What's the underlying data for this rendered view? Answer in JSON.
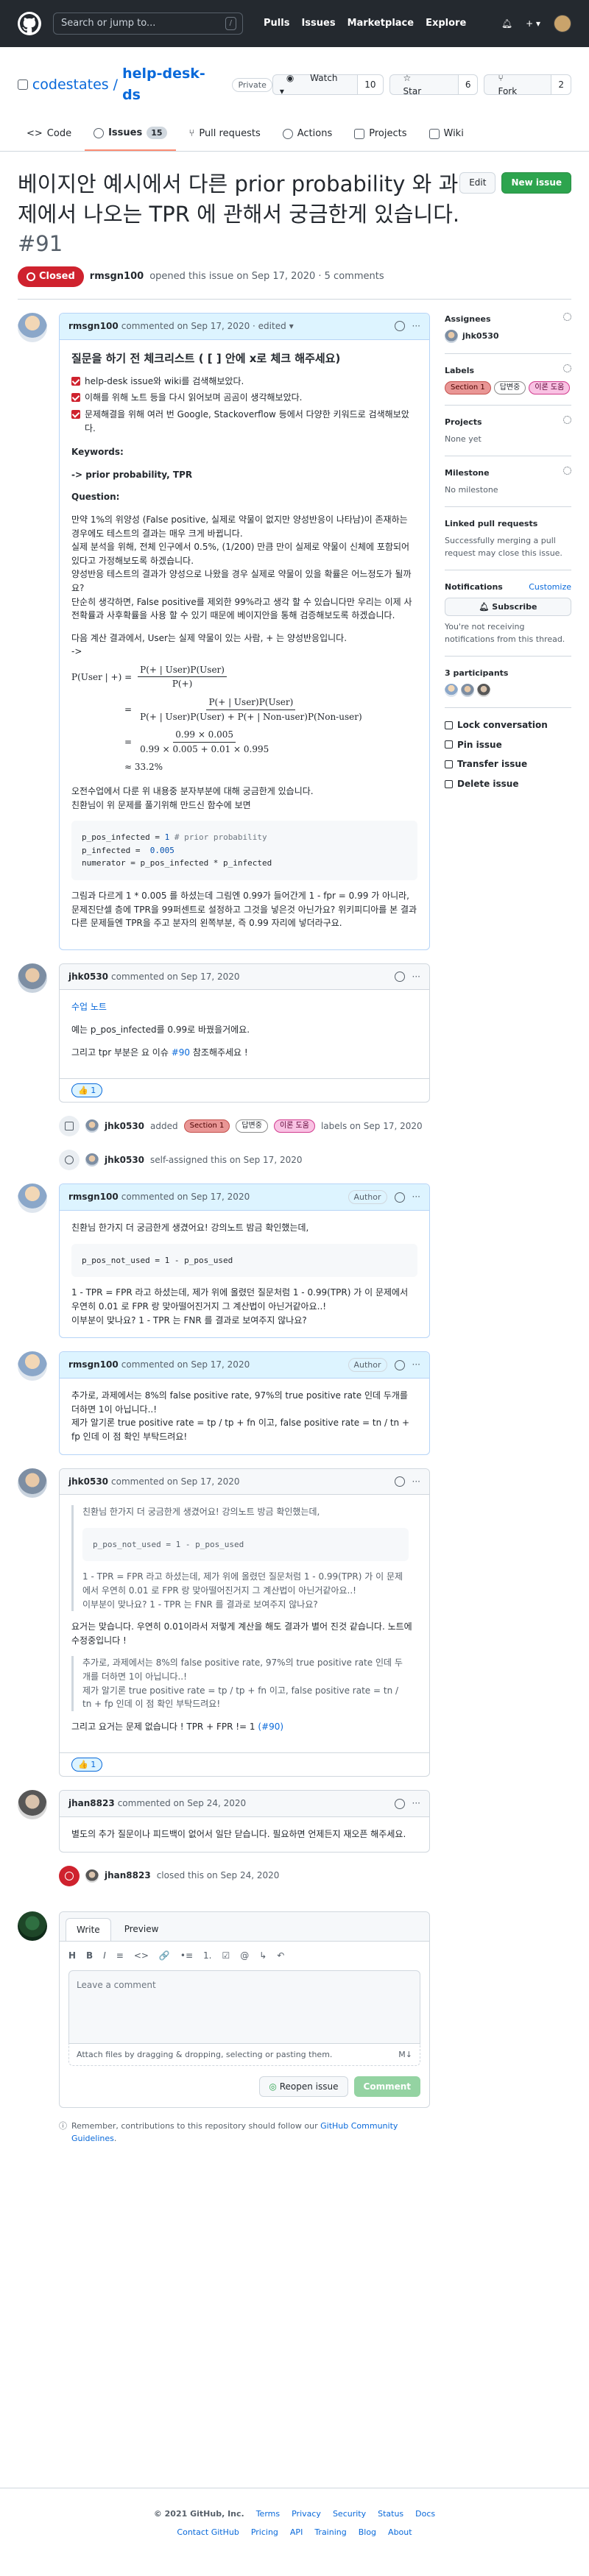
{
  "header": {
    "search_placeholder": "Search or jump to...",
    "search_key": "/",
    "nav": [
      "Pulls",
      "Issues",
      "Marketplace",
      "Explore"
    ]
  },
  "repo": {
    "owner": "codestates",
    "sep": "/",
    "name": "help-desk-ds",
    "visibility": "Private",
    "watch_label": "Watch",
    "watch_count": "10",
    "star_label": "Star",
    "star_count": "6",
    "fork_label": "Fork",
    "fork_count": "2",
    "tabs": [
      {
        "label": "Code"
      },
      {
        "label": "Issues",
        "count": "15"
      },
      {
        "label": "Pull requests"
      },
      {
        "label": "Actions"
      },
      {
        "label": "Projects"
      },
      {
        "label": "Wiki"
      }
    ]
  },
  "issue": {
    "title": "베이지안 예시에서 다른 prior probability 와 과제에서 나오는 TPR 에 관해서 궁금한게 있습니다.",
    "number": "#91",
    "edit_label": "Edit",
    "new_issue_label": "New issue",
    "state": "Closed",
    "author": "rmsgn100",
    "opened_text": "opened this issue on Sep 17, 2020 · 5 comments"
  },
  "comment1": {
    "author": "rmsgn100",
    "meta": "commented on Sep 17, 2020 · edited",
    "heading": "질문을 하기 전 체크리스트 ( [ ] 안에 x로 체크 해주세요)",
    "tasks": [
      "help-desk issue와 wiki를 검색해보았다.",
      "이해를 위해 노트 등을 다시 읽어보며 곰곰이 생각해보았다.",
      "문제해결을 위해 여러 번 Google, Stackoverflow 등에서 다양한 키워드로 검색해보았다."
    ],
    "keywords_label": "Keywords:",
    "keywords": "-> prior probability, TPR",
    "question_label": "Question:",
    "q1": "만약 1%의 위양성 (False positive, 실제로 약물이 없지만 양성반응이 나타남)이 존재하는 경우에도 테스트의 결과는 매우 크게 바뀝니다.",
    "q2": "실제 분석을 위해, 전체 인구에서 0.5%, (1/200) 만큼 만이 실제로 약물이 신체에 포함되어 있다고 가정해보도록 하겠습니다.",
    "q3": "양성반응 테스트의 결과가 양성으로 나왔을 경우 실제로 약물이 있을 확률은 어느정도가 될까요?",
    "q4": "단순히 생각하면, False positive를 제외한 99%라고 생각 할 수 있습니다만 우리는 이제 사전확률과 사후확률을 사용 할 수 있기 때문에 베이지안을 통해 검증해보도록 하겠습니다.",
    "q5": "다음 계산 결과에서, User는 실제 약물이 있는 사람, + 는 양성반응입니다.",
    "q6": "->",
    "math": {
      "lhs": "P(User | +) =",
      "n1": "P(+ | User)P(User)",
      "d1": "P(+)",
      "n2": "P(+ | User)P(User)",
      "d2": "P(+ | User)P(User) + P(+ | Non-user)P(Non-user)",
      "n3": "0.99 × 0.005",
      "d3": "0.99 × 0.005 + 0.01 × 0.995",
      "eq": "=",
      "approx": "≈ 33.2%"
    },
    "p1": "오전수업에서 다룬 위 내용중 분자부분에 대해 궁금한게 있습니다.",
    "p2": "친환님이 위 문제를 풀기위해 만드신 함수에 보면",
    "code": [
      {
        "pre": "p_pos_infected = ",
        "num": "1",
        "cm": " # prior probability"
      },
      {
        "pre": "p_infected = ",
        "num": " 0.005",
        "cm": ""
      },
      {
        "pre": "numerator = p_pos_infected * p_infected",
        "num": "",
        "cm": ""
      }
    ],
    "p3": "그림과 다르게 1 * 0.005 를 하셨는데 그림엔 0.99가 들어간게 1 - fpr = 0.99 가 아니라, 문제진단셀 층에 TPR을 99퍼센트로 설정하고 그것을 넣은것 아닌가요? 위키피디아를 본 결과 다른 문제들엔 TPR을 주고 분자의 왼쪽부분, 즉 0.99 자리에 넣더라구요."
  },
  "comment2": {
    "author": "jhk0530",
    "meta": "commented on Sep 17, 2020",
    "link": "수업 노트",
    "p1": "예는 p_pos_infected를 0.99로 바꿨을거에요.",
    "p2": "그리고 tpr 부분은 요 이슈",
    "ref": "#90",
    "p2b": "참조해주세요 !",
    "reaction": "👍 1"
  },
  "event1": {
    "actor": "jhk0530",
    "action": "added",
    "labels": [
      "Section 1",
      "답변중",
      "이론 도움"
    ],
    "suffix": "labels on Sep 17, 2020"
  },
  "event2": {
    "actor": "jhk0530",
    "text": "self-assigned this on Sep 17, 2020"
  },
  "comment3": {
    "author": "rmsgn100",
    "meta": "commented on Sep 17, 2020",
    "tag": "Author",
    "p1": "친환님 한가지 더 궁금한게 생겼어요! 강의노트 밤금 확인했는데,",
    "code": "p_pos_not_used = 1 - p_pos_used",
    "p2": "1 - TPR = FPR 라고 하셨는데, 제가 위에 올렸던 질문처럼 1 - 0.99(TPR) 가 이 문제에서 우연히 0.01 로 FPR 랑 맞아떨어진거지 그 계산법이 아닌거같아요..!",
    "p3": "이부분이 맞나요? 1 - TPR 는 FNR 를 결과로 보여주지 않나요?"
  },
  "comment4": {
    "author": "rmsgn100",
    "meta": "commented on Sep 17, 2020",
    "tag": "Author",
    "p1": "추가로, 과제에서는 8%의 false positive rate, 97%의 true positive rate 인데 두개를 더하면 1이 아닙니다..!",
    "p2": "제가 알기론 true positive rate = tp / tp + fn 이고, false positive rate = tn / tn + fp 인데 이 점 확인 부탁드려요!"
  },
  "comment5": {
    "author": "jhk0530",
    "meta": "commented on Sep 17, 2020",
    "q1": "친환님 한가지 더 궁금한게 생겼어요! 강의노트 방금 확인했는데,",
    "qcode": "p_pos_not_used = 1 - p_pos_used",
    "q2": "1 - TPR = FPR 라고 하셨는데, 제가 위에 올렸던 질문처럼 1 - 0.99(TPR) 가 이 문제에서 우연히 0.01 로 FPR 랑 맞아떨어진거지 그 계산법이 아닌거같아요..!",
    "q3": "이부분이 맞나요? 1 - TPR 는 FNR 를 결과로 보여주지 않나요?",
    "p1": "요거는 맞습니다. 우연히 0.01이라서 저렇게 계산을 해도 결과가 별어 진것 같습니다. 노트에 수정중입니다 !",
    "q4": "추가로, 과제에서는 8%의 false positive rate, 97%의 true positive rate 인데 두개를 더하면 1이 아닙니다..!",
    "q5": "제가 알기론 true positive rate = tp / tp + fn 이고, false positive rate = tn / tn + fp 인데 이 점 확인 부탁드려요!",
    "p2": "그리고 요거는 문제 없습니다 ! TPR + FPR != 1",
    "ref": "(#90)",
    "reaction": "👍 1"
  },
  "comment6": {
    "author": "jhan8823",
    "meta": "commented on Sep 24, 2020",
    "p1": "별도의 추가 질문이나 피드백이 없어서 일단 닫습니다. 필요하면 언제든지 재오픈 해주세요."
  },
  "event3": {
    "actor": "jhan8823",
    "text": "closed this on Sep 24, 2020"
  },
  "compose": {
    "tab_write": "Write",
    "tab_preview": "Preview",
    "toolbar": [
      "H",
      "B",
      "I",
      "≡",
      "<>",
      "🔗",
      "•≡",
      "1.",
      "☑",
      "@",
      "↳",
      "↶"
    ],
    "placeholder": "Leave a comment",
    "attach": "Attach files by dragging & dropping, selecting or pasting them.",
    "md": "M↓",
    "reopen_label": "Reopen issue",
    "comment_label": "Comment",
    "tip_pre": "Remember, contributions to this repository should follow our",
    "tip_link": "GitHub Community Guidelines",
    "tip_post": "."
  },
  "sidebar": {
    "assignees_label": "Assignees",
    "assignee": "jhk0530",
    "labels_label": "Labels",
    "labels": [
      "Section 1",
      "답변중",
      "이론 도움"
    ],
    "projects_label": "Projects",
    "projects_value": "None yet",
    "milestone_label": "Milestone",
    "milestone_value": "No milestone",
    "linked_label": "Linked pull requests",
    "linked_value": "Successfully merging a pull request may close this issue.",
    "notif_label": "Notifications",
    "customize": "Customize",
    "subscribe": "Subscribe",
    "notif_text": "You're not receiving notifications from this thread.",
    "participants_label": "3 participants",
    "lock": "Lock conversation",
    "pin": "Pin issue",
    "transfer": "Transfer issue",
    "delete": "Delete issue"
  },
  "footer": {
    "copyright": "© 2021 GitHub, Inc.",
    "row1": [
      "Terms",
      "Privacy",
      "Security",
      "Status",
      "Docs"
    ],
    "row2": [
      "Contact GitHub",
      "Pricing",
      "API",
      "Training",
      "Blog",
      "About"
    ]
  },
  "colors": {
    "closed": "#cf222e",
    "label_section": "#e99695",
    "label_answering": "#ffffff",
    "label_theory": "#f9c2e3",
    "new_issue": "#2da44e"
  }
}
